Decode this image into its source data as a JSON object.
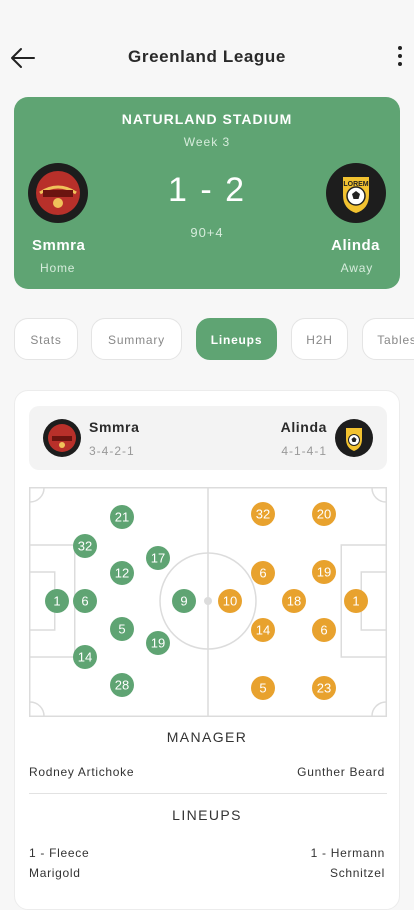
{
  "header": {
    "title": "Greenland League"
  },
  "match": {
    "stadium": "NATURLAND STADIUM",
    "week": "Week 3",
    "score": "1 - 2",
    "time": "90+4",
    "home": {
      "name": "Smmra",
      "role": "Home"
    },
    "away": {
      "name": "Alinda",
      "role": "Away",
      "badge_text": "LOREM"
    }
  },
  "tabs": [
    {
      "label": "Stats",
      "active": false
    },
    {
      "label": "Summary",
      "active": false
    },
    {
      "label": "Lineups",
      "active": true
    },
    {
      "label": "H2H",
      "active": false
    },
    {
      "label": "Tables",
      "active": false
    }
  ],
  "lineup": {
    "home": {
      "name": "Smmra",
      "formation": "3-4-2-1"
    },
    "away": {
      "name": "Alinda",
      "formation": "4-1-4-1"
    },
    "home_players": [
      "1",
      "6",
      "32",
      "14",
      "21",
      "12",
      "5",
      "28",
      "17",
      "19",
      "9"
    ],
    "away_players": [
      "1",
      "19",
      "18",
      "6",
      "20",
      "32",
      "6",
      "14",
      "5",
      "23",
      "10"
    ],
    "manager_heading": "MANAGER",
    "home_manager": "Rodney Artichoke",
    "away_manager": "Gunther Beard",
    "lineups_heading": "LINEUPS",
    "home_first": {
      "line1": "1 - Fleece",
      "line2": "Marigold"
    },
    "away_first": {
      "line1": "1 - Hermann",
      "line2": "Schnitzel"
    }
  },
  "colors": {
    "green": "#5fa473",
    "orange": "#e8a22e"
  }
}
